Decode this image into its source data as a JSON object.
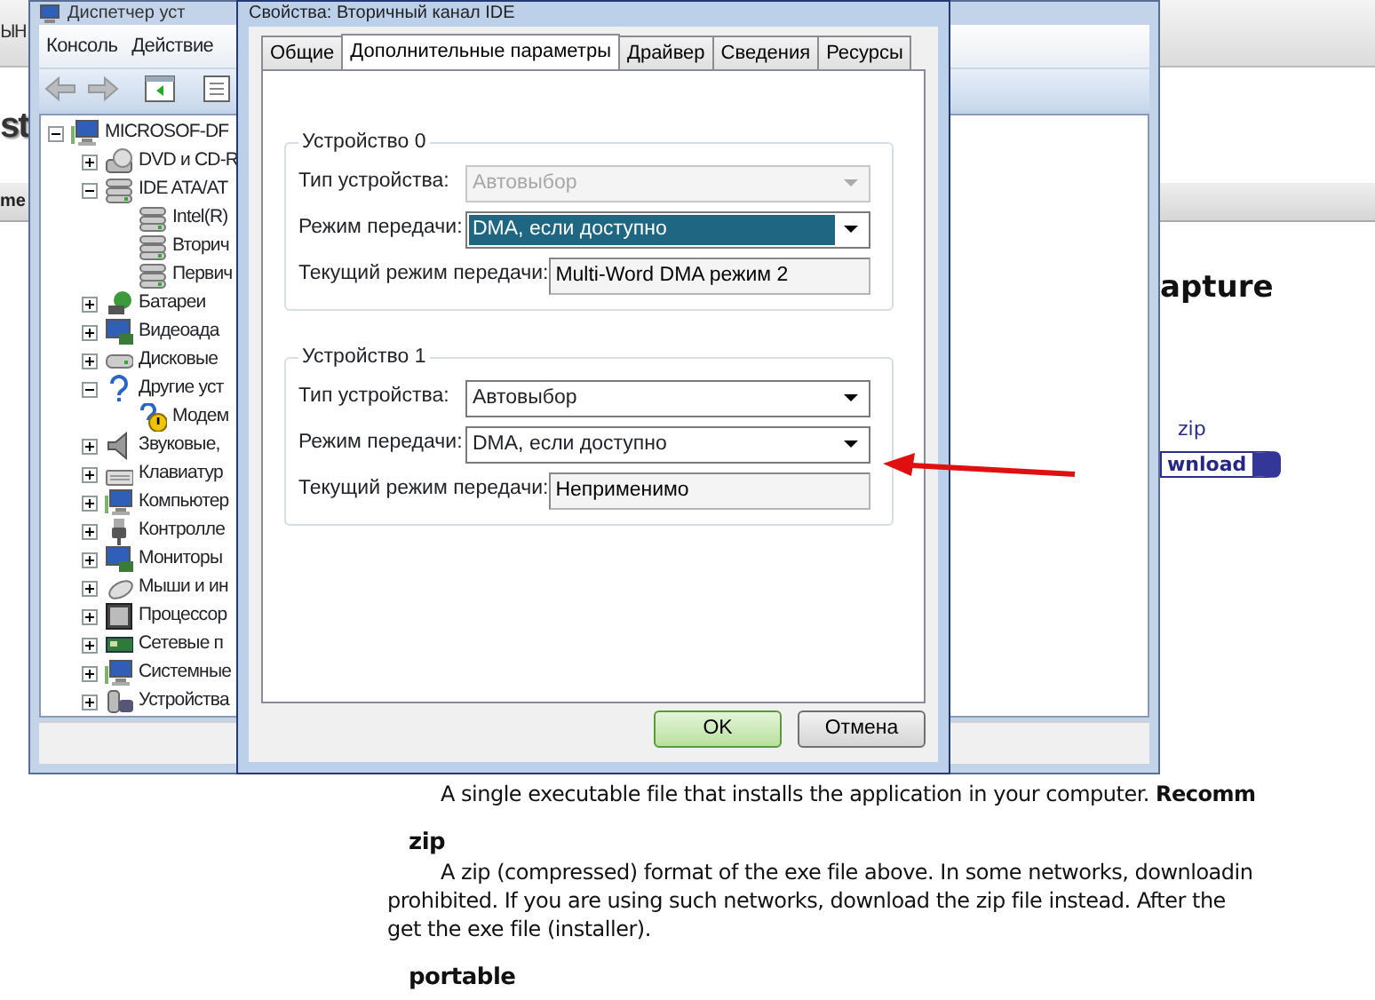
{
  "web_page": {
    "nav_text": "ЫН",
    "logo_text": "st",
    "subnav_text": "me",
    "heading": "apture",
    "download_label": "zip",
    "download_button": "wnload",
    "sections": [
      {
        "lines": [
          "A single executable file that installs the application in your computer. **Recomm**"
        ]
      },
      {
        "title": "zip",
        "lines": [
          "A zip (compressed) format of the exe file above. In some networks, downloadin",
          "prohibited. If you are using such networks, download the zip file instead. After the",
          "get the exe file (installer)."
        ]
      },
      {
        "title": "portable"
      }
    ]
  },
  "device_manager": {
    "title": "Диспетчер уст",
    "menu": [
      "Консоль",
      "Действие"
    ],
    "toolbar": [
      {
        "kind": "back"
      },
      {
        "kind": "forward"
      },
      {
        "kind": "console"
      },
      {
        "kind": "properties"
      }
    ],
    "tree": [
      {
        "label": "MICROSOF-DF",
        "kind": "computer",
        "expanded": true,
        "children": [
          {
            "label": "DVD и CD-R",
            "kind": "disc",
            "expanded": false
          },
          {
            "label": "IDE ATA/AT",
            "kind": "drive",
            "expanded": true,
            "children": [
              {
                "label": "Intel(R)",
                "kind": "drive"
              },
              {
                "label": "Вторич",
                "kind": "drive"
              },
              {
                "label": "Первич",
                "kind": "drive"
              }
            ]
          },
          {
            "label": "Батареи",
            "kind": "battery",
            "expanded": false
          },
          {
            "label": "Видеоада",
            "kind": "display",
            "expanded": false
          },
          {
            "label": "Дисковые",
            "kind": "disk",
            "expanded": false
          },
          {
            "label": "Другие уст",
            "kind": "question",
            "expanded": true,
            "children": [
              {
                "label": "Модем",
                "kind": "warning"
              }
            ]
          },
          {
            "label": "Звуковые,",
            "kind": "sound",
            "expanded": false
          },
          {
            "label": "Клавиатур",
            "kind": "keyboard",
            "expanded": false
          },
          {
            "label": "Компьютер",
            "kind": "computer",
            "expanded": false
          },
          {
            "label": "Контролле",
            "kind": "usb",
            "expanded": false
          },
          {
            "label": "Мониторы",
            "kind": "display",
            "expanded": false
          },
          {
            "label": "Мыши и ин",
            "kind": "mouse",
            "expanded": false
          },
          {
            "label": "Процессор",
            "kind": "cpu",
            "expanded": false
          },
          {
            "label": "Сетевые п",
            "kind": "network",
            "expanded": false
          },
          {
            "label": "Системные",
            "kind": "computer",
            "expanded": false
          },
          {
            "label": "Устройства",
            "kind": "hid",
            "expanded": false
          }
        ]
      }
    ]
  },
  "dialog": {
    "title": "Свойства: Вторичный канал IDE",
    "tabs": [
      {
        "label": "Общие",
        "selected": false
      },
      {
        "label": "Дополнительные параметры",
        "selected": true
      },
      {
        "label": "Драйвер",
        "selected": false
      },
      {
        "label": "Сведения",
        "selected": false
      },
      {
        "label": "Ресурсы",
        "selected": false
      }
    ],
    "groups": [
      {
        "title": "Устройство 0",
        "fields": [
          {
            "kind": "select",
            "label": "Тип устройства:",
            "value": "Автовыбор",
            "disabled": true,
            "focused": false
          },
          {
            "kind": "select",
            "label": "Режим передачи:",
            "value": "DMA, если доступно",
            "disabled": false,
            "focused": true
          },
          {
            "kind": "readonly",
            "label": "Текущий режим передачи:",
            "value": "Multi-Word DMA режим 2"
          }
        ]
      },
      {
        "title": "Устройство 1",
        "fields": [
          {
            "kind": "select",
            "label": "Тип устройства:",
            "value": "Автовыбор",
            "disabled": false,
            "focused": false
          },
          {
            "kind": "select",
            "label": "Режим передачи:",
            "value": "DMA, если доступно",
            "disabled": false,
            "focused": false
          },
          {
            "kind": "readonly",
            "label": "Текущий режим передачи:",
            "value": "Неприменимо"
          }
        ]
      }
    ],
    "buttons": [
      {
        "label": "OK",
        "default": true
      },
      {
        "label": "Отмена",
        "default": false
      }
    ]
  }
}
